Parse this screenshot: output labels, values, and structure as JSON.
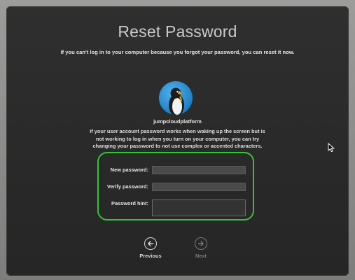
{
  "dialog": {
    "title": "Reset Password",
    "subtitle": "If you can't log in to your computer because you forgot your password, you can reset it now.",
    "username": "jumpcloudplatform",
    "info_lines": [
      "If your user account password works when waking up the screen but is",
      "not working to log in when you turn on your computer, you can try",
      "changing your password to not use complex or accented characters."
    ]
  },
  "form": {
    "new_password_label": "New password:",
    "verify_password_label": "Verify password:",
    "hint_label": "Password hint:",
    "new_password_value": "",
    "verify_password_value": "",
    "hint_value": "",
    "highlight_color": "#35c435"
  },
  "nav": {
    "previous_label": "Previous",
    "next_label": "Next",
    "previous_icon": "arrow-left-circle-icon",
    "next_icon": "arrow-right-circle-icon"
  }
}
